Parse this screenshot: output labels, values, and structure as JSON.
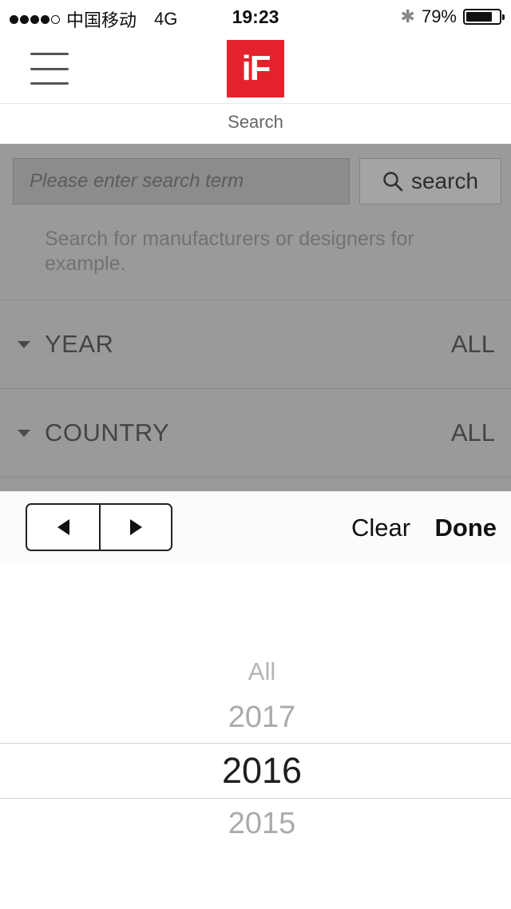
{
  "status_bar": {
    "carrier": "中国移动",
    "network": "4G",
    "time": "19:23",
    "battery": "79%",
    "battery_level": 0.79
  },
  "header": {
    "logo_text": "iF",
    "subtitle": "Search",
    "brand_color": "#e3222b"
  },
  "search": {
    "placeholder": "Please enter search term",
    "button_label": "search",
    "hint": "Search for manufacturers or designers for example."
  },
  "filters": [
    {
      "label": "YEAR",
      "value": "ALL"
    },
    {
      "label": "COUNTRY",
      "value": "ALL"
    }
  ],
  "toolbar": {
    "prev_icon": "triangle-left-icon",
    "next_icon": "triangle-right-icon",
    "clear_label": "Clear",
    "done_label": "Done"
  },
  "picker": {
    "options": [
      "All",
      "2017",
      "2016",
      "2015"
    ],
    "selected": "2016"
  }
}
